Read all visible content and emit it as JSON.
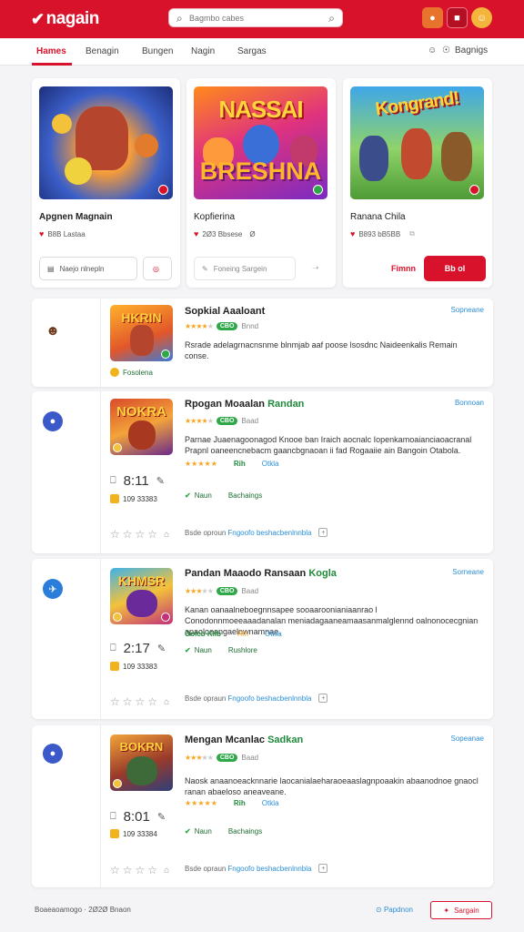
{
  "header": {
    "logo": "nagain",
    "search_placeholder": "Bagmbo cabes",
    "buttons": [
      "avatar-orange",
      "cart",
      "profile"
    ]
  },
  "nav": {
    "tabs": [
      "Hames",
      "Benagin",
      "Bungen",
      "Nagin",
      "Sargas"
    ],
    "active_tab": "Hames",
    "right_label": "Bagnigs"
  },
  "featured": [
    {
      "title": "Apgnen Magnain",
      "meta": "B8B Lastaa",
      "button": "Naejo nlnepln",
      "art_top": "",
      "art_bottom": ""
    },
    {
      "title": "Kopfierina",
      "meta": "2Ø3 Bbsese",
      "extra": "Ø",
      "button": "Foneing Sargein",
      "art_top": "NASSAI",
      "art_bottom": "BRESHNA"
    },
    {
      "title": "Ranana Chila",
      "meta": "B893 bB5BB",
      "button": "Fimnn",
      "red_button": "Bb ol",
      "art_top": "Kongrand!",
      "art_bottom": ""
    }
  ],
  "items": [
    {
      "name": "Sopkial Aaaloant",
      "more": "Sopneane",
      "rating_label": "Bnnd",
      "pill": "CBO",
      "desc": "Rsrade adelagrnacnsnme blnmjab aaf poose lsosdnc Naideenkalis Remain conse.",
      "badge": "Fosolena",
      "thumb_word": "HKRIN"
    },
    {
      "name": "Rpogan Moaalan ",
      "name_tail": "Randan",
      "more": "Bonnoan",
      "rating_label": "Baad",
      "pill": "CBO",
      "desc": "Parnae Juaenagoonagod Knooe ban Iraich aocnalc Iopenkamoaianciaoacranal Prapnl oaneencnebacm gaancbgnaoan ii fad Rogaaiie ain Bangoin Otabola.",
      "tag_gap": "Rih",
      "tag_link": "Otkla",
      "check_label": "Naun",
      "check_link": "Bachaings",
      "stat_big": "8:11",
      "count": "109 33383",
      "foot_text": "Bsde oproun ",
      "foot_link": "Fngoofo beshacbenlnnbla",
      "thumb_word": "NOKRA"
    },
    {
      "name": "Pandan Maaodo Ransaan ",
      "name_tail": "Kogla",
      "more": "Sorneane",
      "rating_label": "Baad",
      "pill": "CBO",
      "desc": "Kanan oanaalneboegnnsapee sooaaroonianiaanrao l Conodonnmoeeaaadanalan meniadagaaneamaasanmalglennd oalnonocecgnian apaoloeangaelnwnamnae.",
      "tag_gap": "Rih",
      "tag_link": "Otkla",
      "check_label": "Naun",
      "check_link": "Rushlore",
      "stat_big": "2:17",
      "count": "109 33383",
      "foot_text": "Bsde opraun ",
      "foot_link": "Fngoofo beshacbenlnnbla",
      "thumb_word": "KHMSR"
    },
    {
      "name": "Mengan Mcanlac ",
      "name_tail": "Sadkan",
      "more": "Sopeanae",
      "rating_label": "Baad",
      "pill": "CBO",
      "desc": "Naosk anaanoeacknnarie laocanialaeharaoeaaslagnpoaakin abaanodnoe gnaocl ranan abaeloso aneaveane.",
      "tag_gap": "Rih",
      "tag_link": "Otkla",
      "check_label": "Naun",
      "check_link": "Bachaings",
      "stat_big": "8:01",
      "count": "109 33384",
      "foot_text": "Bsde opraun ",
      "foot_link": "Fngoofo beshacbenlnnbla",
      "thumb_word": "BOKRN"
    }
  ],
  "footer": {
    "copyright": "Boaeaoamogo · 2Ø2Ø Bnaon",
    "link": "Papdnon",
    "button": "Sargain"
  },
  "colors": {
    "brand": "#d9122b",
    "link": "#2c8fd6",
    "success": "#2fa84a",
    "star": "#f5a623"
  }
}
